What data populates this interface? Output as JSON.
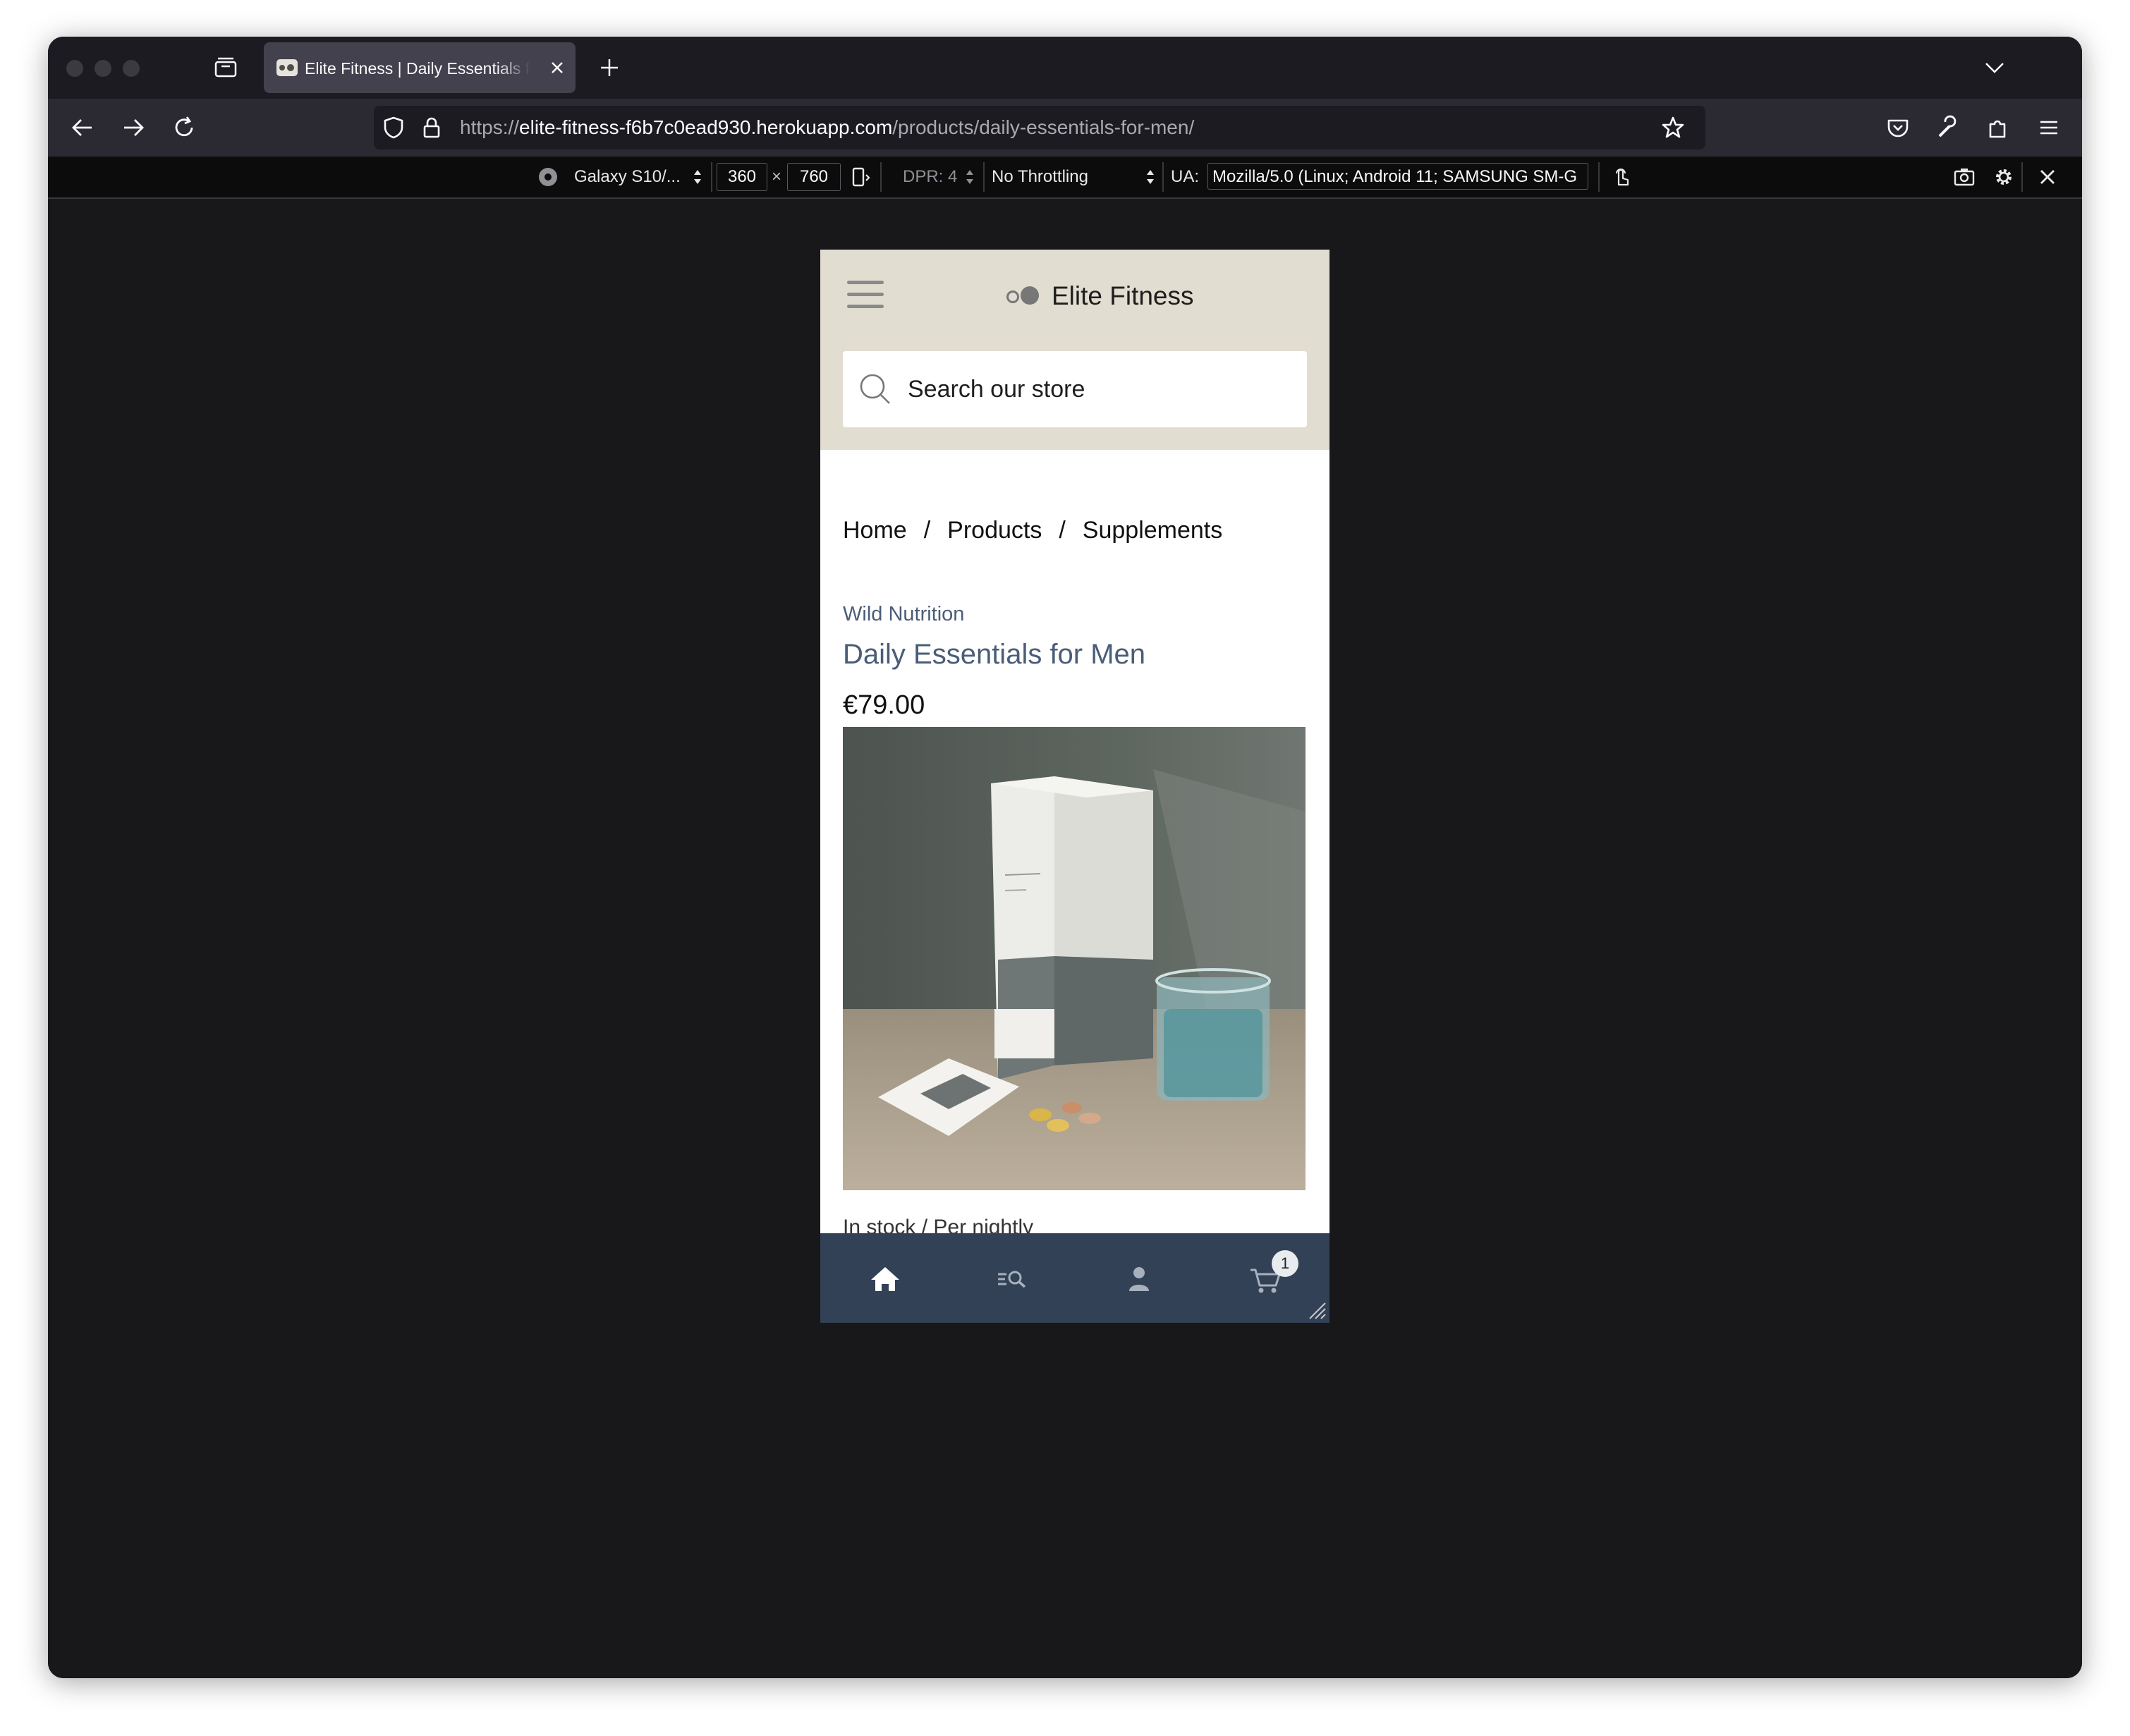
{
  "browser": {
    "tab_title": "Elite Fitness | Daily Essentials for Men",
    "url_prefix": "https://",
    "url_host": "elite-fitness-f6b7c0ead930.herokuapp.com",
    "url_path": "/products/daily-essentials-for-men/"
  },
  "rdm": {
    "device": "Galaxy S10/...",
    "width": "360",
    "times": "×",
    "height": "760",
    "dpr": "DPR: 4",
    "throttling": "No Throttling",
    "ua_label": "UA:",
    "ua_value": "Mozilla/5.0 (Linux; Android 11; SAMSUNG SM-G"
  },
  "site": {
    "name": "Elite Fitness",
    "search_placeholder": "Search our store",
    "breadcrumb": [
      "Home",
      "Products",
      "Supplements"
    ],
    "breadcrumb_sep": "/",
    "brand": "Wild Nutrition",
    "product_title": "Daily Essentials for Men",
    "price": "€79.00",
    "cart_count": "1",
    "partial_text": "In stock / Per nightly"
  },
  "colors": {
    "header_bg": "#e2ddd1",
    "accent_text": "#4a5d78",
    "bottom_nav_bg": "#324155"
  },
  "icons": [
    "hamburger-icon",
    "search-icon",
    "home-icon",
    "browse-icon",
    "account-icon",
    "cart-icon"
  ]
}
